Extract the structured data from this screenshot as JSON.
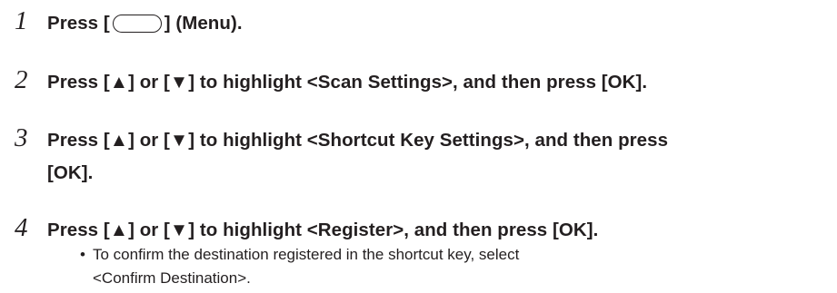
{
  "steps": [
    {
      "number": "1",
      "before": "Press [",
      "key_icon": "menu-key-icon",
      "after": "] (Menu)."
    },
    {
      "number": "2",
      "text": "Press [▲] or [▼] to highlight <Scan Settings>, and then press [OK]."
    },
    {
      "number": "3",
      "line1": "Press [▲] or [▼] to highlight <Shortcut Key Settings>, and then press",
      "line2": "[OK]."
    },
    {
      "number": "4",
      "text": "Press [▲] or [▼] to highlight <Register>, and then press [OK]."
    }
  ],
  "note": {
    "bullet": "•",
    "line1": "To confirm the destination registered in the shortcut key, select",
    "line2": "<Confirm Destination>."
  }
}
